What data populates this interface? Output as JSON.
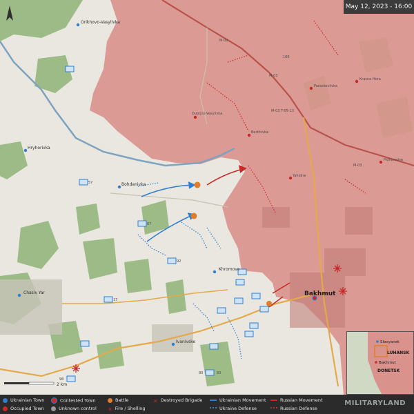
{
  "header": {
    "date_time": "May 12, 2023 - 16:00",
    "compass": "N"
  },
  "towns": [
    "Orikhovo-Vasylivka",
    "Paraskoviivka",
    "Krasna Hora",
    "Dubovo-Vasylivka",
    "Berkhivka",
    "Hryhorivka",
    "Yahidne",
    "Pidhorodne",
    "Bohdanivka",
    "Khromove",
    "Bakhmut",
    "Chasiv Yar",
    "Ivanivske"
  ],
  "roads": [
    "M-03",
    "M-03",
    "M-03 T-05-13",
    "M-03"
  ],
  "unit_labels": [
    "106",
    "57",
    "67",
    "92",
    "17",
    "80",
    "98",
    "80"
  ],
  "scale_label": "2 km",
  "legend": [
    {
      "label": "Ukrainian Town"
    },
    {
      "label": "Contested Town"
    },
    {
      "label": "Battle"
    },
    {
      "label": "Destroyed Brigade"
    },
    {
      "label": "Ukrainian Movement"
    },
    {
      "label": "Russian Movement"
    },
    {
      "label": "Occupied Town"
    },
    {
      "label": "Unknown control"
    },
    {
      "label": "Fire / Shelling"
    },
    {
      "label": "Ukraine Defense"
    },
    {
      "label": "Russian Defense"
    }
  ],
  "brand": "MILITARYLAND",
  "inset": [
    "Slovyansk",
    "LUHANSK",
    "Bakhmut",
    "DONETSK"
  ],
  "colors": {
    "occupied": "#d9928c",
    "terrain": "#e9e7df",
    "forest": "#8fb477",
    "ukraine_blue": "#2f7fd0",
    "russia_red": "#c82a2a",
    "road": "#e4a94a"
  }
}
